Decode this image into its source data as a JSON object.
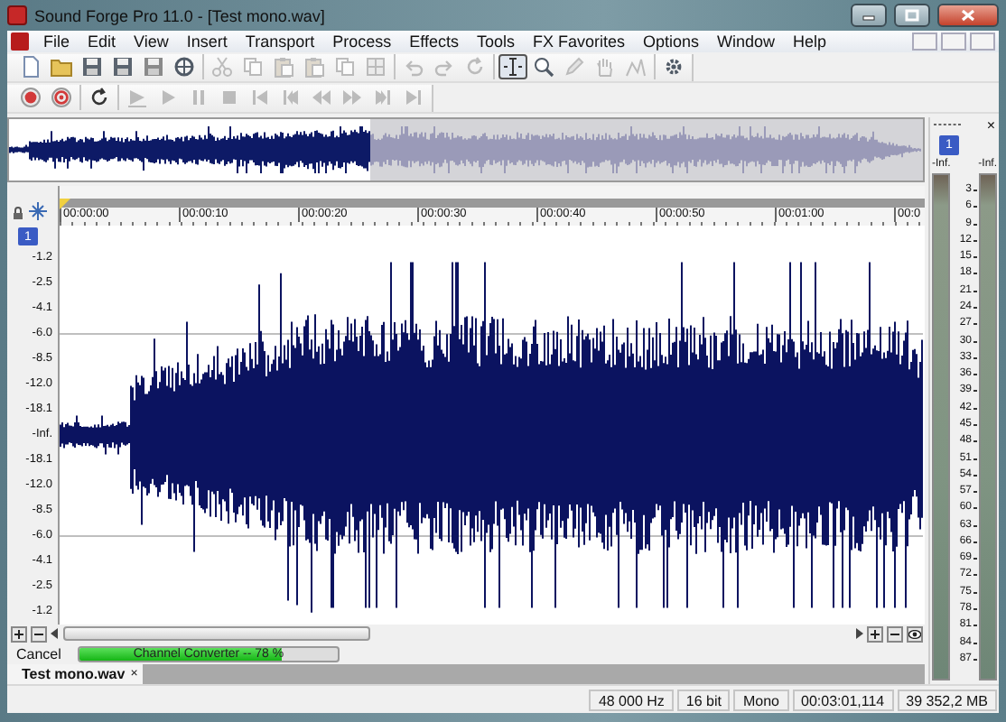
{
  "window": {
    "title": "Sound Forge Pro 11.0 - [Test mono.wav]"
  },
  "menu": [
    "File",
    "Edit",
    "View",
    "Insert",
    "Transport",
    "Process",
    "Effects",
    "Tools",
    "FX Favorites",
    "Options",
    "Window",
    "Help"
  ],
  "toolbars": [
    {
      "groups": [
        [
          {
            "kind": "new",
            "disabled": false,
            "selected": false
          },
          {
            "kind": "open",
            "disabled": false,
            "selected": false
          },
          {
            "kind": "save",
            "disabled": false,
            "selected": false
          },
          {
            "kind": "saveas",
            "disabled": false,
            "selected": false
          },
          {
            "kind": "render",
            "disabled": false,
            "selected": false
          },
          {
            "kind": "print",
            "disabled": false,
            "selected": false
          }
        ],
        [
          {
            "kind": "cut",
            "disabled": true,
            "selected": false
          },
          {
            "kind": "copy",
            "disabled": true,
            "selected": false
          },
          {
            "kind": "paste",
            "disabled": true,
            "selected": false
          },
          {
            "kind": "mix",
            "disabled": true,
            "selected": false
          },
          {
            "kind": "crop",
            "disabled": true,
            "selected": false
          },
          {
            "kind": "trim",
            "disabled": true,
            "selected": false
          }
        ],
        [
          {
            "kind": "undo",
            "disabled": true,
            "selected": false
          },
          {
            "kind": "redo",
            "disabled": true,
            "selected": false
          },
          {
            "kind": "repeat",
            "disabled": true,
            "selected": false
          }
        ],
        [
          {
            "kind": "edit",
            "disabled": false,
            "selected": true
          },
          {
            "kind": "magnify",
            "disabled": false,
            "selected": false
          },
          {
            "kind": "pencil",
            "disabled": true,
            "selected": false
          },
          {
            "kind": "event",
            "disabled": true,
            "selected": false
          },
          {
            "kind": "envelope",
            "disabled": true,
            "selected": false
          }
        ],
        [
          {
            "kind": "props",
            "disabled": false,
            "selected": false
          }
        ]
      ]
    },
    {
      "groups": [
        [
          {
            "kind": "record",
            "disabled": false,
            "selected": false
          },
          {
            "kind": "arm",
            "disabled": false,
            "selected": false
          }
        ],
        [
          {
            "kind": "loop",
            "disabled": false,
            "selected": false
          }
        ],
        [
          {
            "kind": "playall",
            "disabled": true,
            "selected": false
          },
          {
            "kind": "play",
            "disabled": true,
            "selected": false
          },
          {
            "kind": "pause",
            "disabled": true,
            "selected": false
          },
          {
            "kind": "stop",
            "disabled": true,
            "selected": false
          },
          {
            "kind": "start",
            "disabled": true,
            "selected": false
          },
          {
            "kind": "prevmark",
            "disabled": true,
            "selected": false
          },
          {
            "kind": "rewind",
            "disabled": true,
            "selected": false
          },
          {
            "kind": "forward",
            "disabled": true,
            "selected": false
          },
          {
            "kind": "nextmark",
            "disabled": true,
            "selected": false
          },
          {
            "kind": "end",
            "disabled": true,
            "selected": false
          }
        ]
      ]
    }
  ],
  "ruler": [
    "00:00:00",
    "00:00:10",
    "00:00:20",
    "00:00:30",
    "00:00:40",
    "00:00:50",
    "00:01:00",
    "00:0"
  ],
  "track": {
    "channel": "1",
    "scale": [
      "-1.2",
      "-2.5",
      "-4.1",
      "-6.0",
      "-8.5",
      "-12.0",
      "-18.1",
      "-Inf.",
      "-18.1",
      "-12.0",
      "-8.5",
      "-6.0",
      "-4.1",
      "-2.5",
      "-1.2"
    ]
  },
  "progress": {
    "cancel": "Cancel",
    "label": "Channel Converter -- 78 %",
    "level": 0.78
  },
  "tabs": [
    {
      "label": "Test mono.wav",
      "close": "×",
      "selected": true
    }
  ],
  "meter": {
    "close": "×",
    "channel": "1",
    "peaks": [
      "-Inf.",
      "-Inf."
    ],
    "scale": [
      "3",
      "6",
      "9",
      "12",
      "15",
      "18",
      "21",
      "24",
      "27",
      "30",
      "33",
      "36",
      "39",
      "42",
      "45",
      "48",
      "51",
      "54",
      "57",
      "60",
      "63",
      "66",
      "69",
      "72",
      "75",
      "78",
      "81",
      "84",
      "87"
    ]
  },
  "status": [
    "48 000 Hz",
    "16 bit",
    "Mono",
    "00:03:01,114",
    "39 352,2 MB"
  ]
}
